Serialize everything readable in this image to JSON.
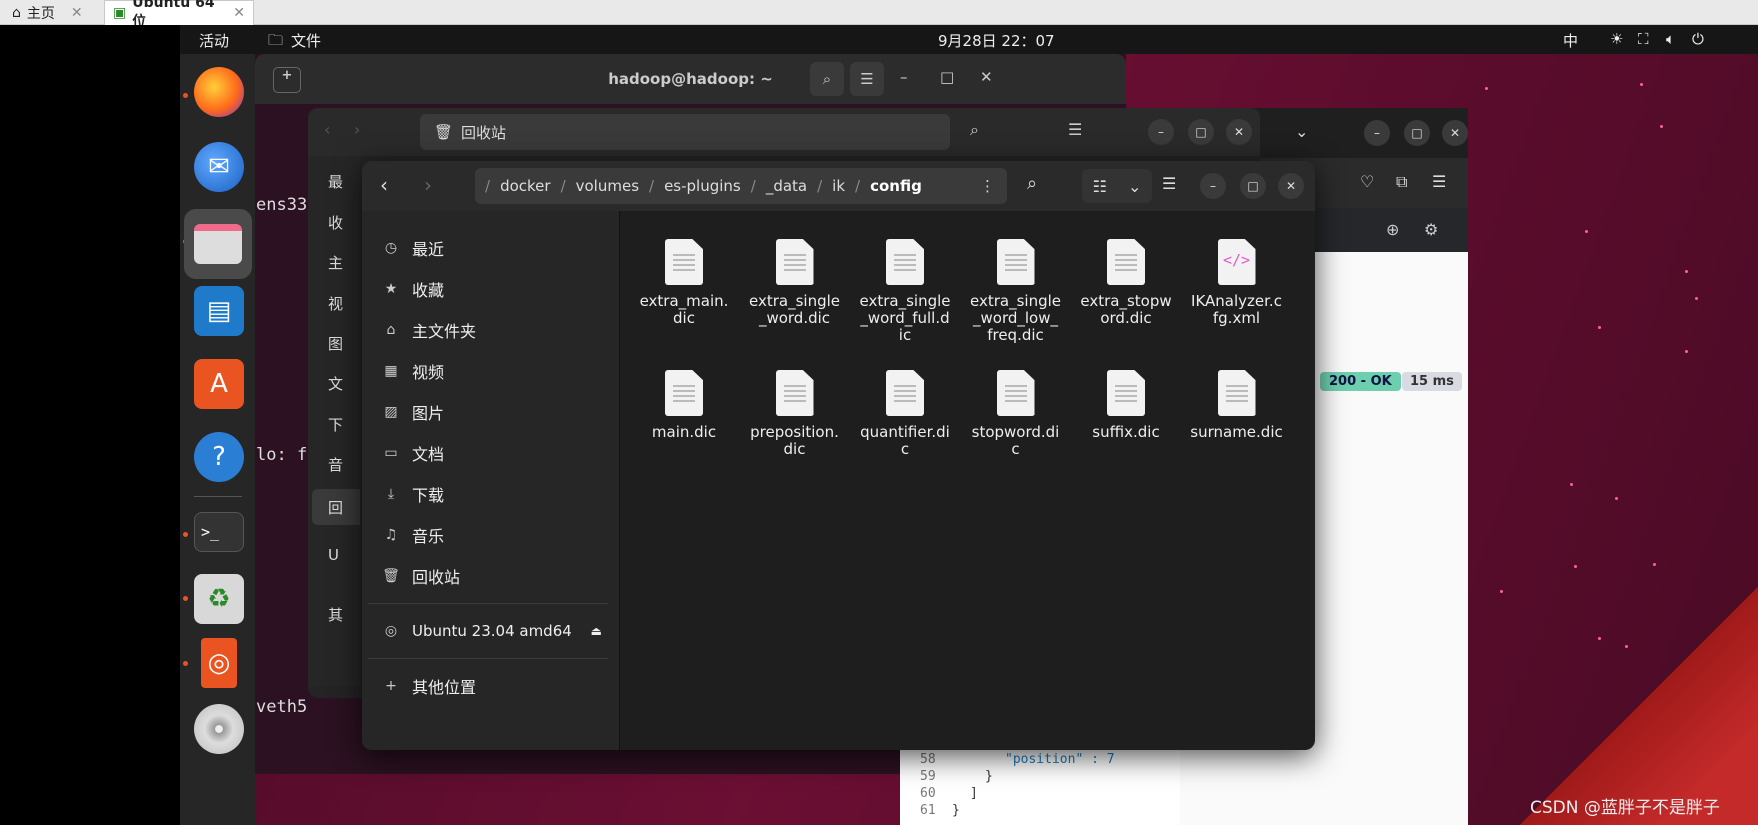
{
  "host_tabs": [
    {
      "label": "主页",
      "close": "✕"
    },
    {
      "label": "Ubuntu 64 位",
      "close": "✕"
    }
  ],
  "topbar": {
    "activities": "活动",
    "files_app": "文件",
    "clock": "9月28日 22：07",
    "input_method": "中"
  },
  "terminal": {
    "title": "hadoop@hadoop: ~",
    "lines": [
      "ens33",
      "lo: f",
      "veth5"
    ]
  },
  "back_window": {
    "path": "回收站",
    "sidebar_items": [
      "最",
      "收",
      "主",
      "视",
      "图",
      "文",
      "下",
      "音",
      "回",
      "U",
      "其"
    ]
  },
  "browser": {
    "status_badge": "200 - OK",
    "time_badge": "15 ms",
    "code_lines": [
      {
        "num": "58",
        "text": "\"position\" : 7"
      },
      {
        "num": "59",
        "text": "}"
      },
      {
        "num": "60",
        "text": "]"
      },
      {
        "num": "61",
        "text": "}"
      }
    ]
  },
  "path_segments": [
    "docker",
    "volumes",
    "es-plugins",
    "_data",
    "ik",
    "config"
  ],
  "sidebar": {
    "items": [
      "最近",
      "收藏",
      "主文件夹",
      "视频",
      "图片",
      "文档",
      "下载",
      "音乐",
      "回收站"
    ],
    "device": "Ubuntu 23.04 amd64",
    "other": "其他位置"
  },
  "files": [
    {
      "name": "extra_main.\ndic",
      "type": "text"
    },
    {
      "name": "extra_single\n_word.dic",
      "type": "text"
    },
    {
      "name": "extra_single\n_word_full.d\nic",
      "type": "text"
    },
    {
      "name": "extra_single\n_word_low_\nfreq.dic",
      "type": "text"
    },
    {
      "name": "extra_stopw\nord.dic",
      "type": "text"
    },
    {
      "name": "IKAnalyzer.c\nfg.xml",
      "type": "xml"
    },
    {
      "name": "main.dic",
      "type": "text"
    },
    {
      "name": "preposition.\ndic",
      "type": "text"
    },
    {
      "name": "quantifier.di\nc",
      "type": "text"
    },
    {
      "name": "stopword.di\nc",
      "type": "text"
    },
    {
      "name": "suffix.dic",
      "type": "text"
    },
    {
      "name": "surname.dic",
      "type": "text"
    }
  ],
  "watermark": "CSDN @蓝胖子不是胖子",
  "colors": {
    "accent": "#e95420",
    "ok_badge": "#5ec7a6"
  }
}
